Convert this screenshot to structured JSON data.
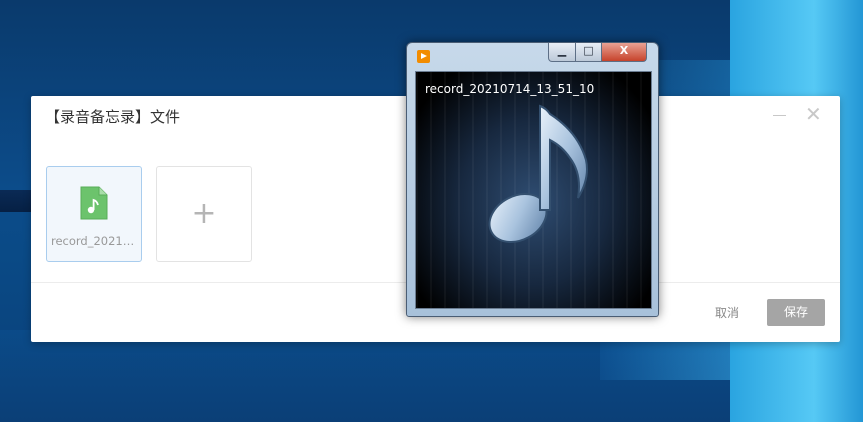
{
  "dialog": {
    "title": "【录音备忘录】文件",
    "file": {
      "name": "record_20210…",
      "icon": "audio-file-icon",
      "accent": "#5cb85c"
    },
    "add_symbol": "+",
    "cancel_label": "取消",
    "save_label": "保存",
    "minimize_symbol": "—",
    "close_symbol": "✕"
  },
  "player": {
    "media_name": "record_20210714_13_51_10",
    "caption": {
      "minimize": "▁",
      "maximize": "□",
      "close": "X"
    },
    "icon": "media-player-icon",
    "artwork": "music-note-icon"
  }
}
